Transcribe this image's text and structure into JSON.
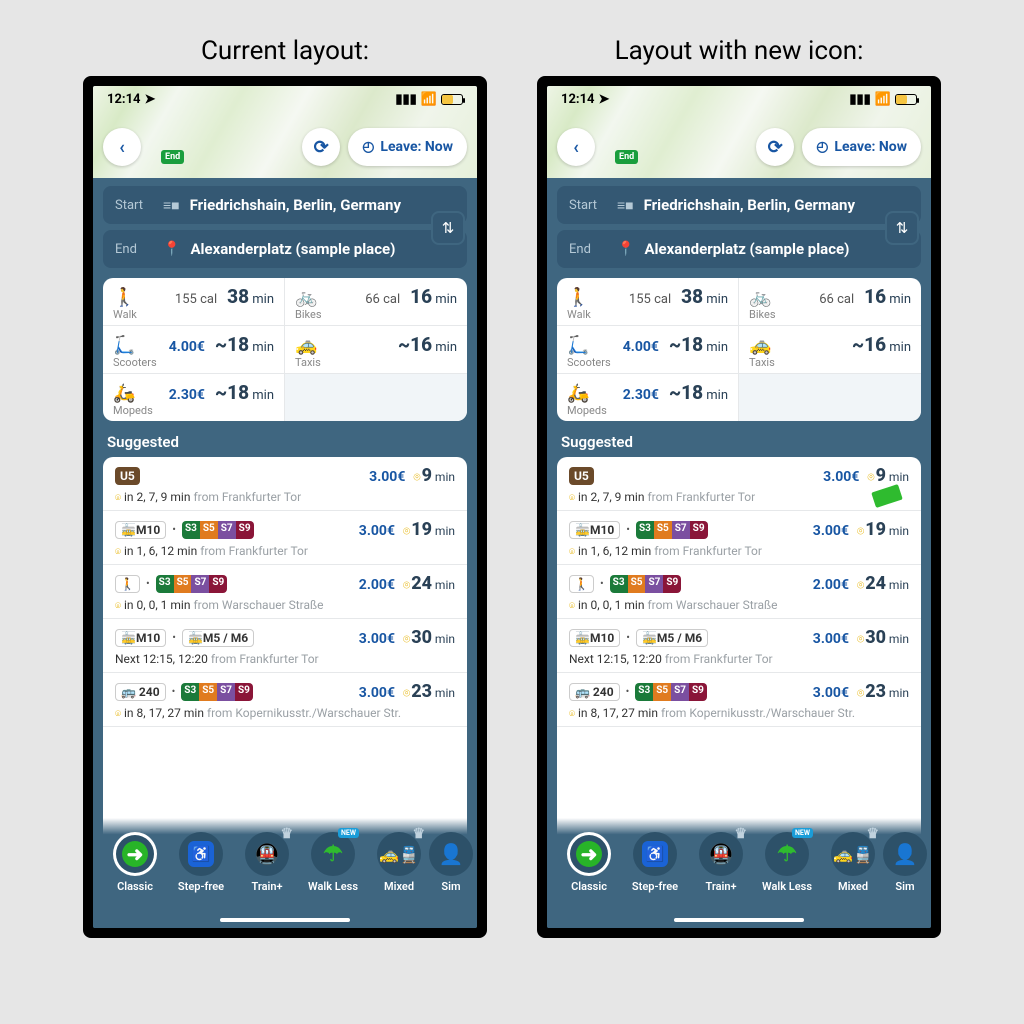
{
  "titles": {
    "left": "Current layout:",
    "right": "Layout with new icon:"
  },
  "status": {
    "time": "12:14"
  },
  "map": {
    "leave_label": "Leave: Now",
    "end_pin": "End"
  },
  "search": {
    "start_label": "Start",
    "start_value": "Friedrichshain, Berlin, Germany",
    "end_label": "End",
    "end_value": "Alexanderplatz (sample place)"
  },
  "modes": {
    "walk": {
      "label": "Walk",
      "cal": "155 cal",
      "time_num": "38",
      "time_unit": "min"
    },
    "bikes": {
      "label": "Bikes",
      "cal": "66 cal",
      "time_num": "16",
      "time_unit": "min"
    },
    "scooters": {
      "label": "Scooters",
      "price": "4.00€",
      "time_num": "~18",
      "time_unit": "min"
    },
    "taxis": {
      "label": "Taxis",
      "time_num": "~16",
      "time_unit": "min"
    },
    "mopeds": {
      "label": "Mopeds",
      "price": "2.30€",
      "time_num": "~18",
      "time_unit": "min"
    }
  },
  "suggested_title": "Suggested",
  "routes": [
    {
      "line_badge": "U5",
      "badge_class": "brown",
      "price": "3.00€",
      "dur_num": "9",
      "dur_unit": "min",
      "departs": "in 2, 7, 9 min",
      "from": "from Frankfurter Tor"
    },
    {
      "tram": "M10",
      "sbahn": [
        "S3",
        "S5",
        "S7",
        "S9"
      ],
      "price": "3.00€",
      "dur_num": "19",
      "dur_unit": "min",
      "departs": "in 1, 6, 12 min",
      "from": "from Frankfurter Tor"
    },
    {
      "walker": true,
      "sbahn": [
        "S3",
        "S5",
        "S7",
        "S9"
      ],
      "price": "2.00€",
      "dur_num": "24",
      "dur_unit": "min",
      "departs": "in 0, 0, 1 min",
      "from": "from Warschauer Straße"
    },
    {
      "tram": "M10",
      "tram2": "M5 / M6",
      "price": "3.00€",
      "dur_num": "30",
      "dur_unit": "min",
      "departs_prefix": "Next ",
      "departs": "12:15, 12:20",
      "from": "from Frankfurter Tor"
    },
    {
      "bus": "240",
      "sbahn": [
        "S3",
        "S5",
        "S7",
        "S9"
      ],
      "price": "3.00€",
      "dur_num": "23",
      "dur_unit": "min",
      "departs": "in 8, 17, 27 min",
      "from": "from Kopernikusstr./Warschauer Str."
    }
  ],
  "tabs": [
    {
      "label": "Classic",
      "active": true
    },
    {
      "label": "Step-free"
    },
    {
      "label": "Train+",
      "crown": true
    },
    {
      "label": "Walk Less",
      "new": true
    },
    {
      "label": "Mixed",
      "crown": true
    },
    {
      "label": "Sim"
    }
  ]
}
